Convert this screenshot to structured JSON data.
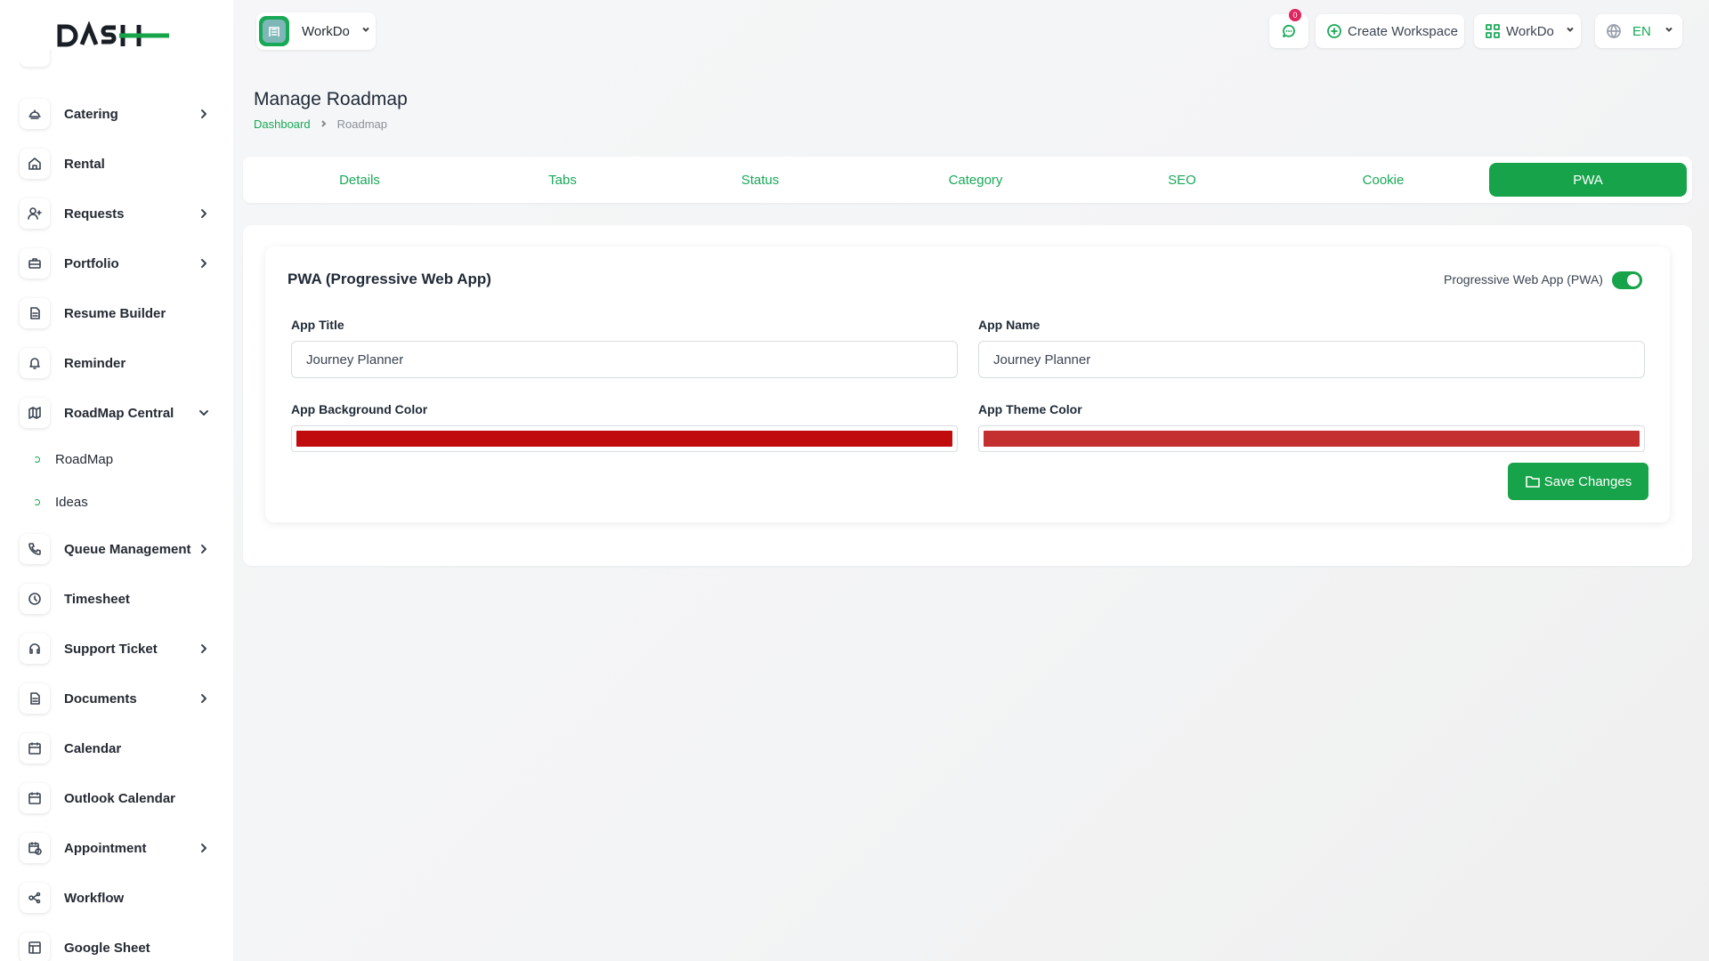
{
  "sidebar": {
    "logo_text": "DASH",
    "items": [
      {
        "label": "Catering",
        "icon": "catering-icon",
        "has_children": true
      },
      {
        "label": "Rental",
        "icon": "home-icon",
        "has_children": false
      },
      {
        "label": "Requests",
        "icon": "user-plus-icon",
        "has_children": true
      },
      {
        "label": "Portfolio",
        "icon": "briefcase-icon",
        "has_children": true
      },
      {
        "label": "Resume Builder",
        "icon": "file-icon",
        "has_children": false
      },
      {
        "label": "Reminder",
        "icon": "bell-icon",
        "has_children": false
      },
      {
        "label": "RoadMap Central",
        "icon": "map-icon",
        "has_children": true,
        "expanded": true
      },
      {
        "label": "Queue Management",
        "icon": "phone-icon",
        "has_children": true
      },
      {
        "label": "Timesheet",
        "icon": "clock-icon",
        "has_children": false
      },
      {
        "label": "Support Ticket",
        "icon": "headset-icon",
        "has_children": true
      },
      {
        "label": "Documents",
        "icon": "document-icon",
        "has_children": true
      },
      {
        "label": "Calendar",
        "icon": "calendar-icon",
        "has_children": false
      },
      {
        "label": "Outlook Calendar",
        "icon": "calendar-icon",
        "has_children": false
      },
      {
        "label": "Appointment",
        "icon": "calendar-clock-icon",
        "has_children": true
      },
      {
        "label": "Workflow",
        "icon": "workflow-icon",
        "has_children": false
      },
      {
        "label": "Google Sheet",
        "icon": "table-icon",
        "has_children": false
      }
    ],
    "sub_items": [
      {
        "label": "RoadMap"
      },
      {
        "label": "Ideas"
      }
    ]
  },
  "topbar": {
    "workspace_name": "WorkDo",
    "notification_count": "0",
    "create_workspace_label": "Create Workspace",
    "workspace_menu_label": "WorkDo",
    "language": "EN"
  },
  "header": {
    "title": "Manage Roadmap",
    "breadcrumb_home": "Dashboard",
    "breadcrumb_current": "Roadmap"
  },
  "tabs": [
    {
      "label": "Details",
      "active": false
    },
    {
      "label": "Tabs",
      "active": false
    },
    {
      "label": "Status",
      "active": false
    },
    {
      "label": "Category",
      "active": false
    },
    {
      "label": "SEO",
      "active": false
    },
    {
      "label": "Cookie",
      "active": false
    },
    {
      "label": "PWA",
      "active": true
    }
  ],
  "pwa": {
    "card_title": "PWA (Progressive Web App)",
    "toggle_label": "Progressive Web App (PWA)",
    "toggle_on": true,
    "app_title_label": "App Title",
    "app_title_value": "Journey Planner",
    "app_name_label": "App Name",
    "app_name_value": "Journey Planner",
    "bg_color_label": "App Background Color",
    "bg_color_value": "#c00c0c",
    "theme_color_label": "App Theme Color",
    "theme_color_value": "#c42f2f",
    "save_label": "Save Changes"
  },
  "colors": {
    "primary": "#17a34a",
    "link": "#18a957"
  }
}
